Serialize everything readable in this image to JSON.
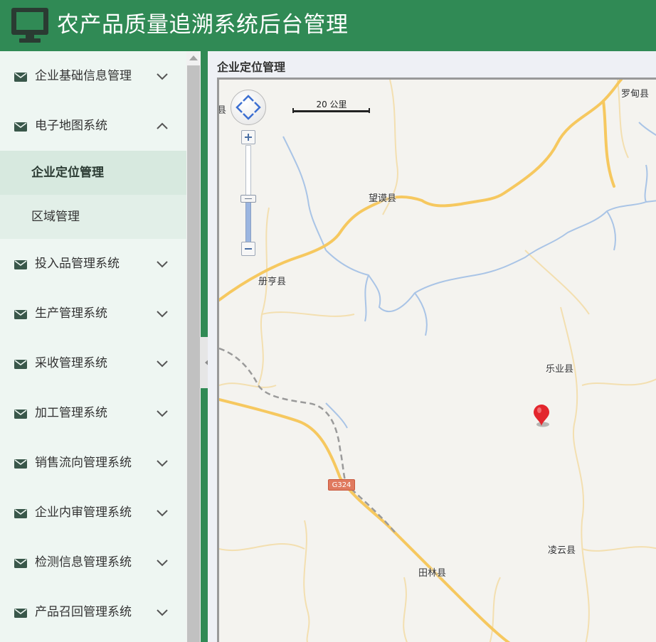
{
  "header": {
    "title": "农产品质量追溯系统后台管理"
  },
  "sidebar": {
    "items": [
      {
        "label": "企业基础信息管理",
        "expanded": false
      },
      {
        "label": "电子地图系统",
        "expanded": true,
        "children": [
          {
            "label": "企业定位管理",
            "active": true
          },
          {
            "label": "区域管理",
            "active": false
          }
        ]
      },
      {
        "label": "投入品管理系统",
        "expanded": false
      },
      {
        "label": "生产管理系统",
        "expanded": false
      },
      {
        "label": "采收管理系统",
        "expanded": false
      },
      {
        "label": "加工管理系统",
        "expanded": false
      },
      {
        "label": "销售流向管理系统",
        "expanded": false
      },
      {
        "label": "企业内审管理系统",
        "expanded": false
      },
      {
        "label": "检测信息管理系统",
        "expanded": false
      },
      {
        "label": "产品召回管理系统",
        "expanded": false
      }
    ]
  },
  "content": {
    "title": "企业定位管理"
  },
  "map": {
    "scale": "20 公里",
    "road_shield": "G324",
    "places": {
      "p1": "县",
      "p2": "罗甸县",
      "p3": "望谟县",
      "p4": "册亨县",
      "p5": "乐业县",
      "p6": "凌云县",
      "p7": "田林县"
    }
  },
  "colors": {
    "primary": "#308a55",
    "sidebar_bg": "#eef6f2",
    "road": "#f6c85f",
    "water": "#a7c3e6",
    "marker": "#e3262d"
  },
  "icons": {
    "logo": "monitor-icon",
    "menu": "envelope-icon",
    "collapsed": "chevron-down-icon",
    "expanded": "chevron-up-icon"
  }
}
